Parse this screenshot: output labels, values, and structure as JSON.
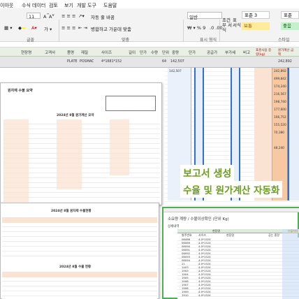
{
  "menu": [
    "이아웃",
    "수식",
    "데이터",
    "검토",
    "보기",
    "개발 도구",
    "도움말"
  ],
  "ribbon": {
    "font_size": "11",
    "wrap_text_label": "자동 줄 바꿈",
    "merge_label": "병합하고 가운데 맞춤",
    "number_format": "일반",
    "conditional_format": "조건부 서식",
    "table_format": "표 서식",
    "style_normal_3": "표준 3",
    "style_normal": "표준",
    "style_neutral": "보통",
    "style_good": "좋음",
    "group_font": "글꼴",
    "group_align": "맞춤",
    "group_number": "표시 형식",
    "group_style": "스타일"
  },
  "header_row": [
    "현장명",
    "고객사",
    "품명",
    "재질",
    "사이즈",
    "길이",
    "단가",
    "수량",
    "단위",
    "중량",
    "단가",
    "공급가",
    "부가세",
    "비고",
    "표준사용 중량(kg)",
    "원가계산 금액"
  ],
  "data_row": [
    "PLATE",
    "POSMAC",
    "4*1681*152",
    "64",
    "142,507",
    "242,892"
  ],
  "report1": {
    "title": "원자재 수불 요약",
    "subtitle": "2024년 8월 원가계산 요약"
  },
  "report2": {
    "title1": "2024년 8월 원자재 수불현황",
    "title2": "2024년 8월 수불 현황"
  },
  "right_col": [
    "142,507",
    "",
    "",
    "",
    "",
    "",
    "",
    "",
    "",
    "",
    "",
    "",
    "",
    "",
    "",
    "",
    "",
    "",
    "",
    "",
    "",
    "",
    "",
    "",
    "",
    ""
  ],
  "orange_col": [
    "242,892",
    "499,842",
    "174,240",
    "216,567",
    "198,740",
    "177,600",
    "106,752",
    "155,520",
    "70,380",
    "",
    "48,240",
    "",
    ""
  ],
  "overlay": {
    "line1": "보고서 생성",
    "line2": "수율 및 원가계산 자동화"
  },
  "inner_sheet": {
    "title": "소요량 계량 / 수불이상확인 (단위 Kg)",
    "filter_label": "상세내역",
    "col_a": "현장명",
    "col_b": "발주번호",
    "col_c": "사이즈",
    "col_d": "현장명",
    "col_e": "공는 중량",
    "col_f": "수불차이",
    "rows": [
      [
        "06086",
        "4.0*1524"
      ],
      [
        "06089",
        "4.0*1524"
      ],
      [
        "06090",
        "4.0*1524"
      ],
      [
        "06091",
        "4.0*1524"
      ],
      [
        "06092",
        "4.0*1524"
      ],
      [
        "06093",
        "4.0*1524"
      ],
      [
        "06094",
        "4.0*1524"
      ],
      [
        "21",
        "4.0*1524"
      ],
      [
        "1403",
        "4.0*1524"
      ],
      [
        "1903",
        "4.0*1524"
      ],
      [
        "1904",
        "4.0*1524"
      ],
      [
        "1905",
        "4.0*1524"
      ],
      [
        "1906",
        "4.0*1524"
      ],
      [
        "1907",
        "4.0*1524"
      ],
      [
        "1908",
        "4.0*1524"
      ],
      [
        "1909",
        "4.0*1524"
      ],
      [
        "1910",
        "4.0*1524"
      ],
      [
        "1911",
        "4.0*1524"
      ]
    ]
  },
  "colors": {
    "accent_green": "#6b9d1e",
    "border_blue": "#2f6fd8",
    "border_green": "#4caf50",
    "orange": "#f7c9a2",
    "peach": "#fbe3d3"
  }
}
